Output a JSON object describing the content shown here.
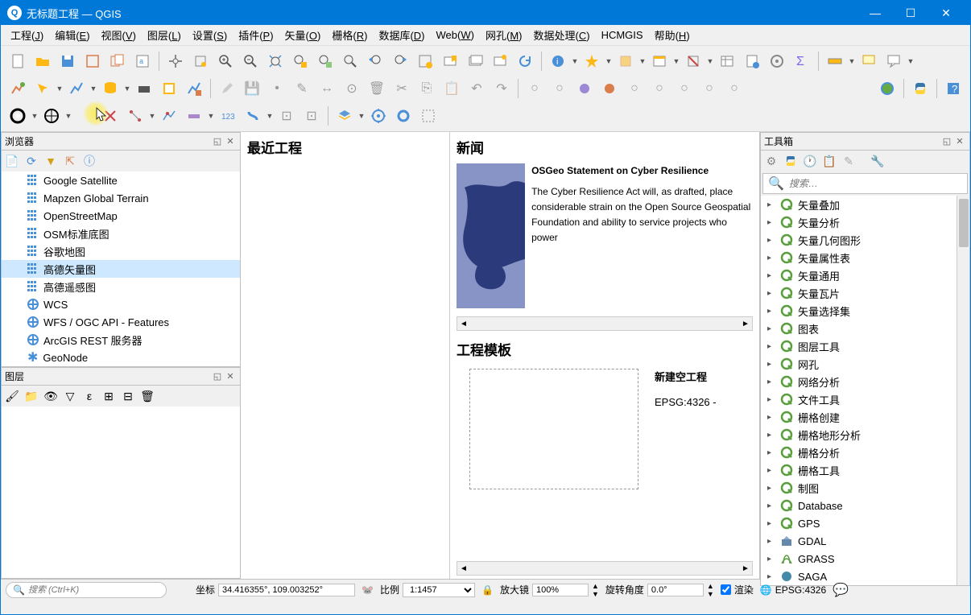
{
  "titlebar": {
    "title": "无标题工程 — QGIS"
  },
  "menu": [
    "工程(J)",
    "编辑(E)",
    "视图(V)",
    "图层(L)",
    "设置(S)",
    "插件(P)",
    "矢量(O)",
    "栅格(R)",
    "数据库(D)",
    "Web(W)",
    "网孔(M)",
    "数据处理(C)",
    "HCMGIS",
    "帮助(H)"
  ],
  "browser_panel": {
    "title": "浏览器",
    "items": [
      {
        "icon": "grid",
        "label": "Google Satellite"
      },
      {
        "icon": "grid",
        "label": "Mapzen Global Terrain"
      },
      {
        "icon": "grid",
        "label": "OpenStreetMap"
      },
      {
        "icon": "grid",
        "label": "OSM标准底图"
      },
      {
        "icon": "grid",
        "label": "谷歌地图"
      },
      {
        "icon": "grid",
        "label": "高德矢量图",
        "selected": true
      },
      {
        "icon": "grid",
        "label": "高德遥感图"
      },
      {
        "icon": "globe",
        "label": "WCS"
      },
      {
        "icon": "globe",
        "label": "WFS / OGC API - Features"
      },
      {
        "icon": "globe",
        "label": "ArcGIS REST 服务器"
      },
      {
        "icon": "star",
        "label": "GeoNode"
      }
    ]
  },
  "layers_panel": {
    "title": "图层"
  },
  "center": {
    "recent_title": "最近工程",
    "news_title": "新闻",
    "news_headline": "OSGeo Statement on Cyber Resilience",
    "news_body": "The Cyber Resilience Act will, as drafted, place considerable strain on the Open Source Geospatial Foundation and ability to service projects who power",
    "templates_title": "工程模板",
    "template_name": "新建空工程",
    "template_crs": "EPSG:4326 - "
  },
  "toolbox": {
    "title": "工具箱",
    "search_placeholder": "搜索…",
    "items": [
      {
        "icon": "q",
        "label": "矢量叠加"
      },
      {
        "icon": "q",
        "label": "矢量分析"
      },
      {
        "icon": "q",
        "label": "矢量几何图形"
      },
      {
        "icon": "q",
        "label": "矢量属性表"
      },
      {
        "icon": "q",
        "label": "矢量通用"
      },
      {
        "icon": "q",
        "label": "矢量瓦片"
      },
      {
        "icon": "q",
        "label": "矢量选择集"
      },
      {
        "icon": "q",
        "label": "图表"
      },
      {
        "icon": "q",
        "label": "图层工具"
      },
      {
        "icon": "q",
        "label": "网孔"
      },
      {
        "icon": "q",
        "label": "网络分析"
      },
      {
        "icon": "q",
        "label": "文件工具"
      },
      {
        "icon": "q",
        "label": "栅格创建"
      },
      {
        "icon": "q",
        "label": "栅格地形分析"
      },
      {
        "icon": "q",
        "label": "栅格分析"
      },
      {
        "icon": "q",
        "label": "栅格工具"
      },
      {
        "icon": "q",
        "label": "制图"
      },
      {
        "icon": "q",
        "label": "Database"
      },
      {
        "icon": "q",
        "label": "GPS"
      },
      {
        "icon": "gdal",
        "label": "GDAL"
      },
      {
        "icon": "grass",
        "label": "GRASS"
      },
      {
        "icon": "saga",
        "label": "SAGA"
      }
    ]
  },
  "statusbar": {
    "search_placeholder": "搜索 (Ctrl+K)",
    "coord_label": "坐标",
    "coord_value": "34.416355°, 109.003252°",
    "scale_label": "比例",
    "scale_value": "1:1457",
    "magnifier_label": "放大镜",
    "magnifier_value": "100%",
    "rotation_label": "旋转角度",
    "rotation_value": "0.0°",
    "render_label": "渲染",
    "crs_label": "EPSG:4326"
  }
}
